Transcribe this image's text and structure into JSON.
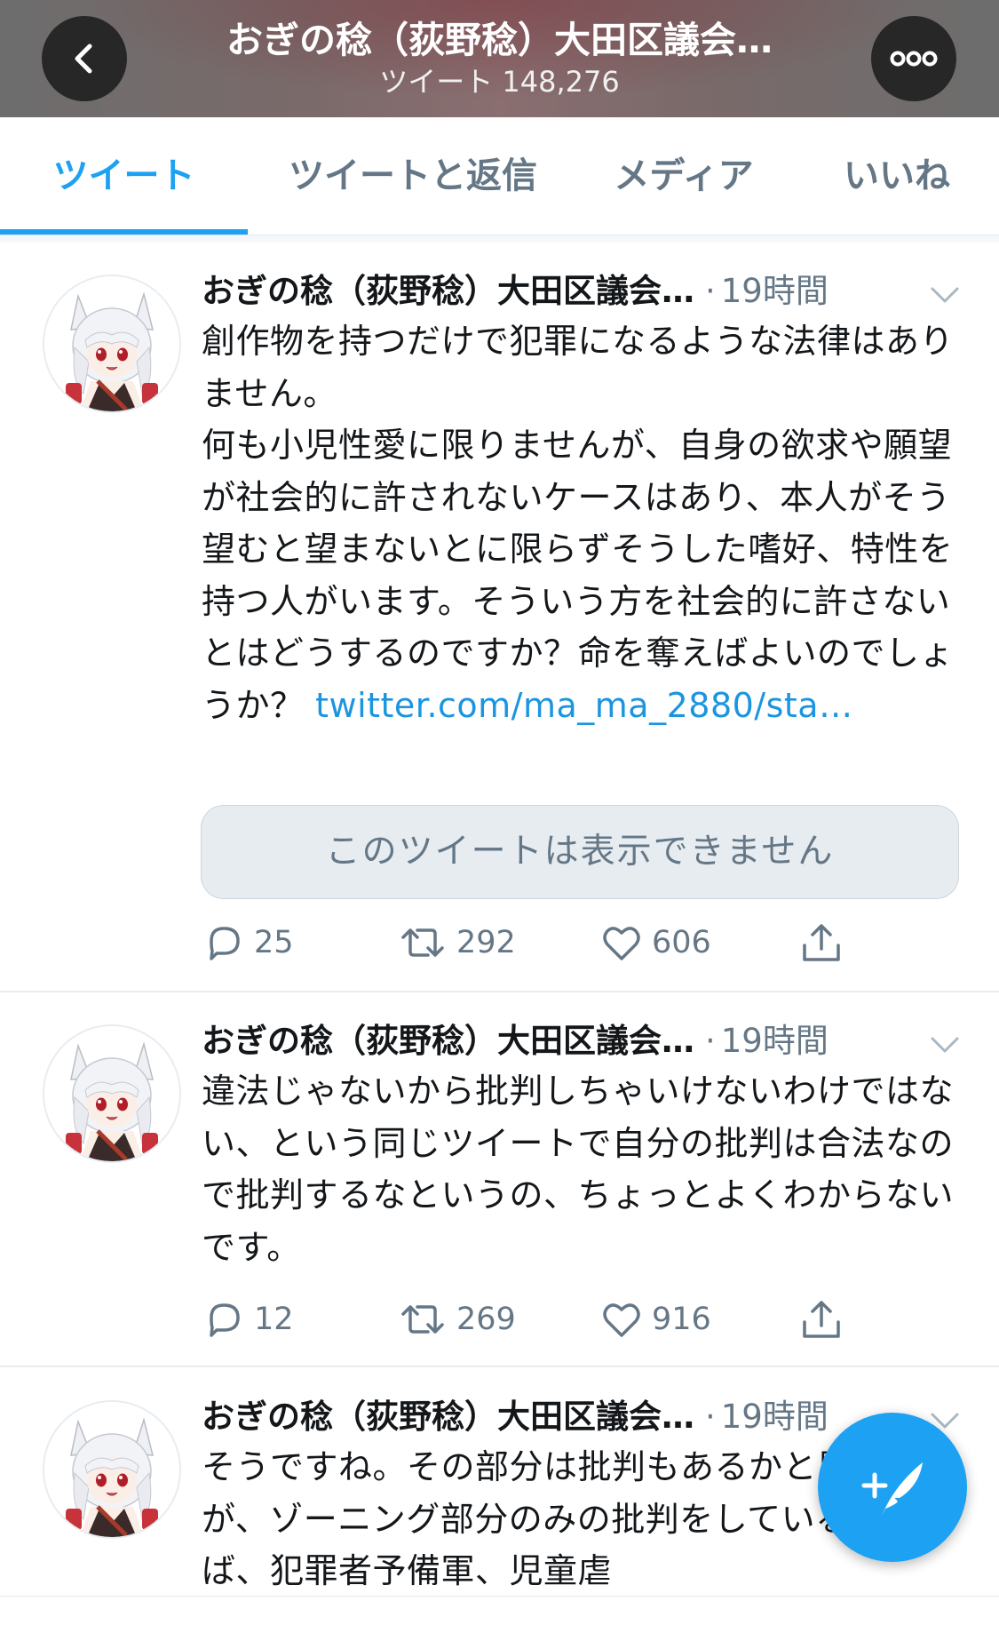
{
  "header": {
    "title": "おぎの稔（荻野稔）大田区議会…",
    "subtitle": "ツイート 148,276",
    "back_icon": "chevron-left-icon",
    "more_icon": "more-dots-icon"
  },
  "tabs": [
    {
      "label": "ツイート",
      "active": true
    },
    {
      "label": "ツイートと返信",
      "active": false
    },
    {
      "label": "メディア",
      "active": false
    },
    {
      "label": "いいね",
      "active": false
    }
  ],
  "colors": {
    "accent": "#1da1f2",
    "link": "#1b95e0",
    "secondary_text": "#657786"
  },
  "tweets": [
    {
      "name": "おぎの稔（荻野稔）大田区議会…",
      "dot": "·",
      "time": "19時間",
      "text": "創作物を持つだけで犯罪になるような法律はありません。\n何も小児性愛に限りませんが、自身の欲求や願望が社会的に許されないケースはあり、本人がそう望むと望まないとに限らずそうした嗜好、特性を持つ人がいます。そういう方を社会的に許さないとはどうするのですか？命を奪えばよいのでしょうか？ ",
      "link": "twitter.com/ma_ma_2880/sta…",
      "quote_unavailable": "このツイートは表示できません",
      "replies": "25",
      "retweets": "292",
      "likes": "606"
    },
    {
      "name": "おぎの稔（荻野稔）大田区議会…",
      "dot": "·",
      "time": "19時間",
      "text": "違法じゃないから批判しちゃいけないわけではない、という同じツイートで自分の批判は合法なので批判するなというの、ちょっとよくわからないです。",
      "replies": "12",
      "retweets": "269",
      "likes": "916"
    },
    {
      "name": "おぎの稔（荻野稔）大田区議会…",
      "dot": "·",
      "time": "19時間",
      "text": "そうですね。その部分は批判もあるかと思いますが、ゾーニング部分のみの批判をしているのならば、犯罪者予備軍、児童虐"
    }
  ],
  "fab": {
    "icon": "compose-tweet-icon"
  }
}
